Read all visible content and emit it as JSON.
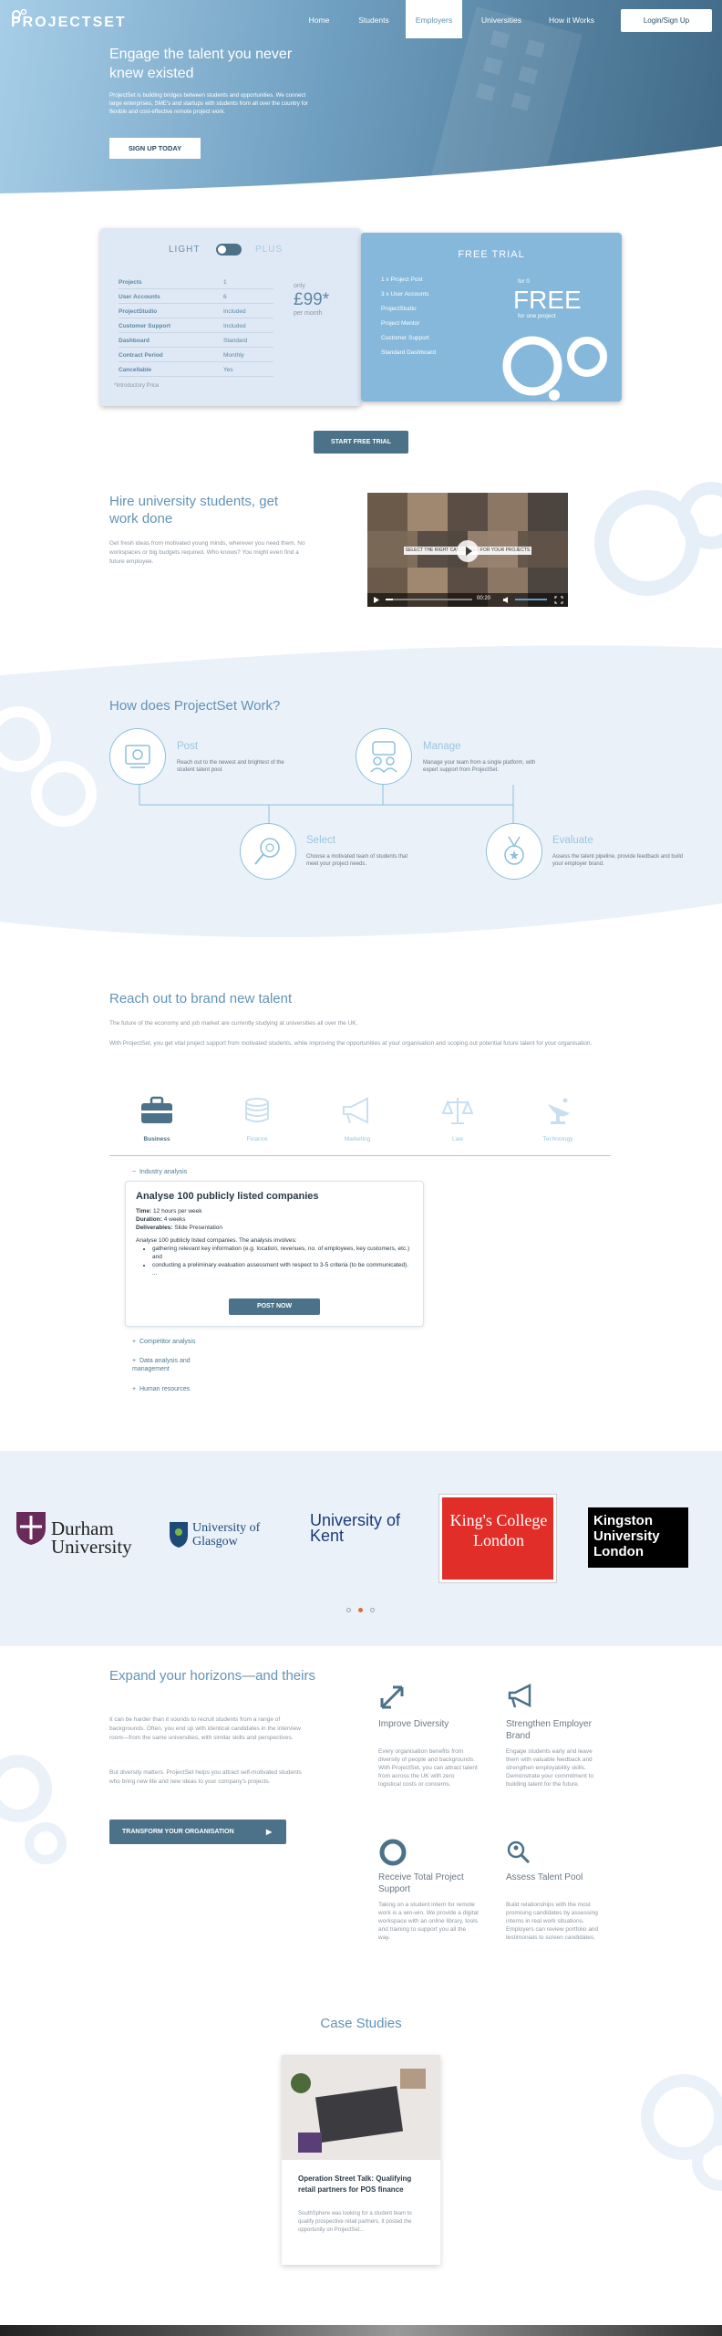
{
  "brand": {
    "logo": "PROJECTSET"
  },
  "nav": {
    "items": [
      "Home",
      "Students",
      "Employers",
      "Universities",
      "How it Works"
    ],
    "active": "Employers",
    "login": "Login/Sign Up"
  },
  "hero": {
    "title": "Engage the talent you never knew existed",
    "body": "ProjectSet is building bridges between students and opportunities. We connect large enterprises, SME's and startups with students from all over the country for flexible and cost-effective remote project work.",
    "cta": "SIGN UP TODAY"
  },
  "pricing": {
    "toggle_left": "LIGHT",
    "toggle_right": "PLUS",
    "rows": [
      {
        "label": "Projects",
        "value": "1"
      },
      {
        "label": "User Accounts",
        "value": "6"
      },
      {
        "label": "ProjectStudio",
        "value": "Included"
      },
      {
        "label": "Customer Support",
        "value": "Included"
      },
      {
        "label": "Dashboard",
        "value": "Standard"
      },
      {
        "label": "Contract Period",
        "value": "Monthly"
      },
      {
        "label": "Cancellable",
        "value": "Yes"
      }
    ],
    "price_prefix": "only",
    "price": "£99*",
    "price_suffix": "per month",
    "footnote": "*Introductory Price",
    "trial_title": "FREE TRIAL",
    "trial_items": [
      "1 x Project Post",
      "3 x User Accounts",
      "ProjectStudio",
      "Project Mentor",
      "Customer Support",
      "Standard Dashboard"
    ],
    "trial_for": "for 0",
    "trial_price": "FREE",
    "trial_sub": "for one project",
    "cta": "START FREE TRIAL"
  },
  "hire": {
    "title": "Hire university students, get work done",
    "body": "Get fresh ideas from motivated young minds, wherever you need them. No workspaces or big budgets required. Who knows? You might even find a future employee.",
    "video": {
      "caption": "SELECT THE RIGHT CANDIDATES FOR YOUR PROJECTS",
      "time": "00:20"
    }
  },
  "how": {
    "title": "How does ProjectSet Work?",
    "steps": [
      {
        "title": "Post",
        "text": "Reach out to the newest and brightest of the student talent pool.",
        "icon": "post-icon"
      },
      {
        "title": "Manage",
        "text": "Manage your team from a single platform, with expert support from ProjectSet.",
        "icon": "team-icon"
      },
      {
        "title": "Select",
        "text": "Choose a motivated team of students that meet your project needs.",
        "icon": "search-icon"
      },
      {
        "title": "Evaluate",
        "text": "Assess the talent pipeline, provide feedback and build your employer brand.",
        "icon": "medal-icon"
      }
    ]
  },
  "reach": {
    "title": "Reach out to brand new talent",
    "p1": "The future of the economy and job market are currently studying at universities all over the UK.",
    "p2": "With ProjectSet, you get vital project support from motivated students, while improving the opportunities at your organisation and scoping out potential future talent for your organisation.",
    "categories": [
      "Business",
      "Finance",
      "Marketing",
      "Law",
      "Technology"
    ],
    "active_category": "Business",
    "accordion": [
      "Industry analysis",
      "Competitor analysis",
      "Data analysis and management",
      "Human resources"
    ],
    "project": {
      "title": "Analyse 100 publicly listed companies",
      "time_label": "Time:",
      "time": "12 hours per week",
      "duration_label": "Duration:",
      "duration": "4 weeks",
      "deliverables_label": "Deliverables:",
      "deliverables": "Slide Presentation",
      "intro": "Analyse 100 publicly listed companies. The analysis involves:",
      "bullets": [
        "gathering relevant key information (e.g. location, revenues, no. of employees, key customers, etc.) and",
        "conducting a preliminary evaluation assessment with respect to 3-5 criteria (to be communicated).",
        "..."
      ],
      "cta": "POST NOW"
    }
  },
  "universities": {
    "logos": [
      "Durham University",
      "University of Glasgow",
      "University of Kent",
      "King's College London",
      "Kingston University London"
    ]
  },
  "expand": {
    "title": "Expand your horizons—and theirs",
    "p1": "It can be harder than it sounds to recruit students from a range of backgrounds. Often, you end up with identical candidates in the interview room—from the same universities, with similar skills and perspectives.",
    "p2": "But diversity matters. ProjectSet helps you attract self-motivated students who bring new life and new ideas to your company's projects.",
    "cta": "TRANSFORM YOUR ORGANISATION",
    "features": [
      {
        "title": "Improve Diversity",
        "text": "Every organisation benefits from diversity of people and backgrounds. With ProjectSet, you can attract talent from across the UK with zero logistical costs or concerns.",
        "icon": "expand-arrows-icon"
      },
      {
        "title": "Strengthen Employer Brand",
        "text": "Engage students early and leave them with valuable feedback and strengthen employability skills. Demonstrate your commitment to building talent for the future.",
        "icon": "megaphone-icon"
      },
      {
        "title": "Receive Total Project Support",
        "text": "Taking on a student intern for remote work is a win-win. We provide a digital workspace with an online library, tools and training to support you all the way.",
        "icon": "lifebuoy-icon"
      },
      {
        "title": "Assess Talent Pool",
        "text": "Build relationships with the most promising candidates by assessing interns in real work situations. Employers can review portfolio and testimonials to screen candidates.",
        "icon": "magnifier-person-icon"
      }
    ]
  },
  "cases": {
    "title": "Case Studies",
    "card_title": "Operation Street Talk: Qualifying retail partners for POS finance",
    "card_text": "SouthSphere was looking for a student team to qualify prospective retail partners. It posted the opportunity on ProjectSet..."
  },
  "colors": {
    "accent": "#6393b6",
    "dark_button": "#4b7288",
    "light_blue": "#85b8da"
  }
}
